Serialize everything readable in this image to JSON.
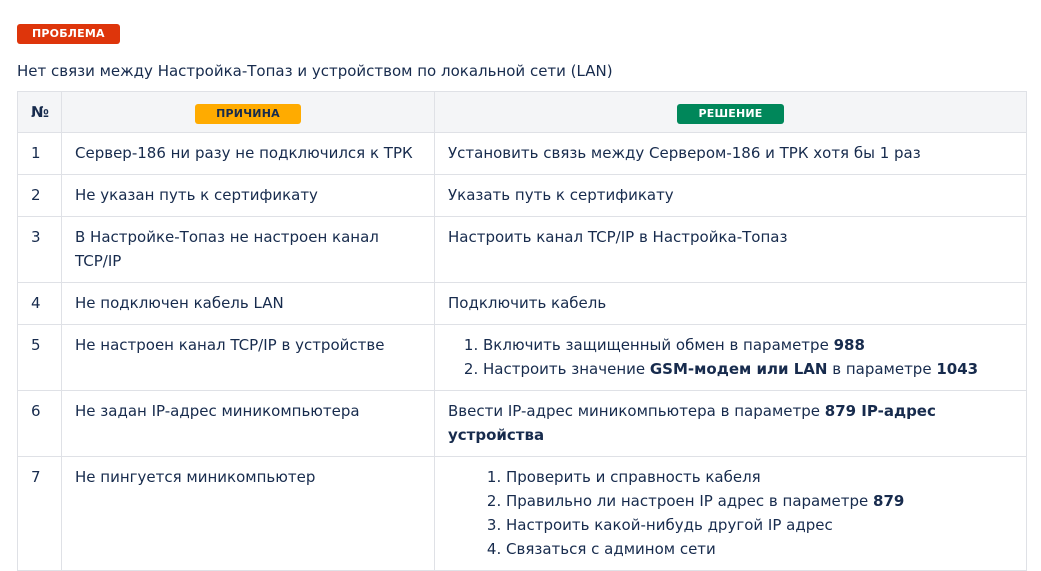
{
  "problem": {
    "badge": "ПРОБЛЕМА",
    "text": "Нет связи между Настройка-Топаз и устройством по локальной сети (LAN)"
  },
  "table": {
    "headers": {
      "num": "№",
      "cause": "ПРИЧИНА",
      "solution": "РЕШЕНИЕ"
    },
    "rows": [
      {
        "num": "1",
        "cause": "Сервер-186 ни разу не подключился к ТРК",
        "solution": "Установить связь между Сервером-186 и ТРК хотя бы 1 раз"
      },
      {
        "num": "2",
        "cause": "Не указан путь к сертификату",
        "solution": "Указать путь к сертификату"
      },
      {
        "num": "3",
        "cause": "В Настройке-Топаз не настроен канал TCP/IP",
        "solution": "Настроить канал TCP/IP в Настройка-Топаз"
      },
      {
        "num": "4",
        "cause": "Не подключен кабель LAN",
        "solution": "Подключить кабель"
      },
      {
        "num": "5",
        "cause": "Не настроен канал TCP/IP в устройстве",
        "steps": [
          {
            "prefix": "Включить защищенный обмен в параметре ",
            "bold": "988",
            "middle": "",
            "bold2": ""
          },
          {
            "prefix": "Настроить значение ",
            "bold": "GSM-модем или LAN",
            "middle": " в параметре ",
            "bold2": "1043"
          }
        ]
      },
      {
        "num": "6",
        "cause": "Не задан IP-адрес миникомпьютера",
        "solution_prefix": "Ввести IP-адрес миникомпьютера в параметре ",
        "solution_bold": "879 IP-адрес устройства"
      },
      {
        "num": "7",
        "cause": "Не пингуется миникомпьютер",
        "steps": [
          {
            "prefix": "Проверить и справность кабеля",
            "bold": ""
          },
          {
            "prefix": "Правильно ли настроен IP адрес в параметре ",
            "bold": "879"
          },
          {
            "prefix": "Настроить какой-нибудь другой IP адрес",
            "bold": ""
          },
          {
            "prefix": "Связаться с админом сети",
            "bold": ""
          }
        ]
      }
    ]
  },
  "colors": {
    "problem_badge": "#de350b",
    "cause_badge": "#ffab00",
    "solution_badge": "#00875a",
    "header_bg": "#f4f5f7",
    "border": "#dfe1e6",
    "text": "#172b4d"
  }
}
